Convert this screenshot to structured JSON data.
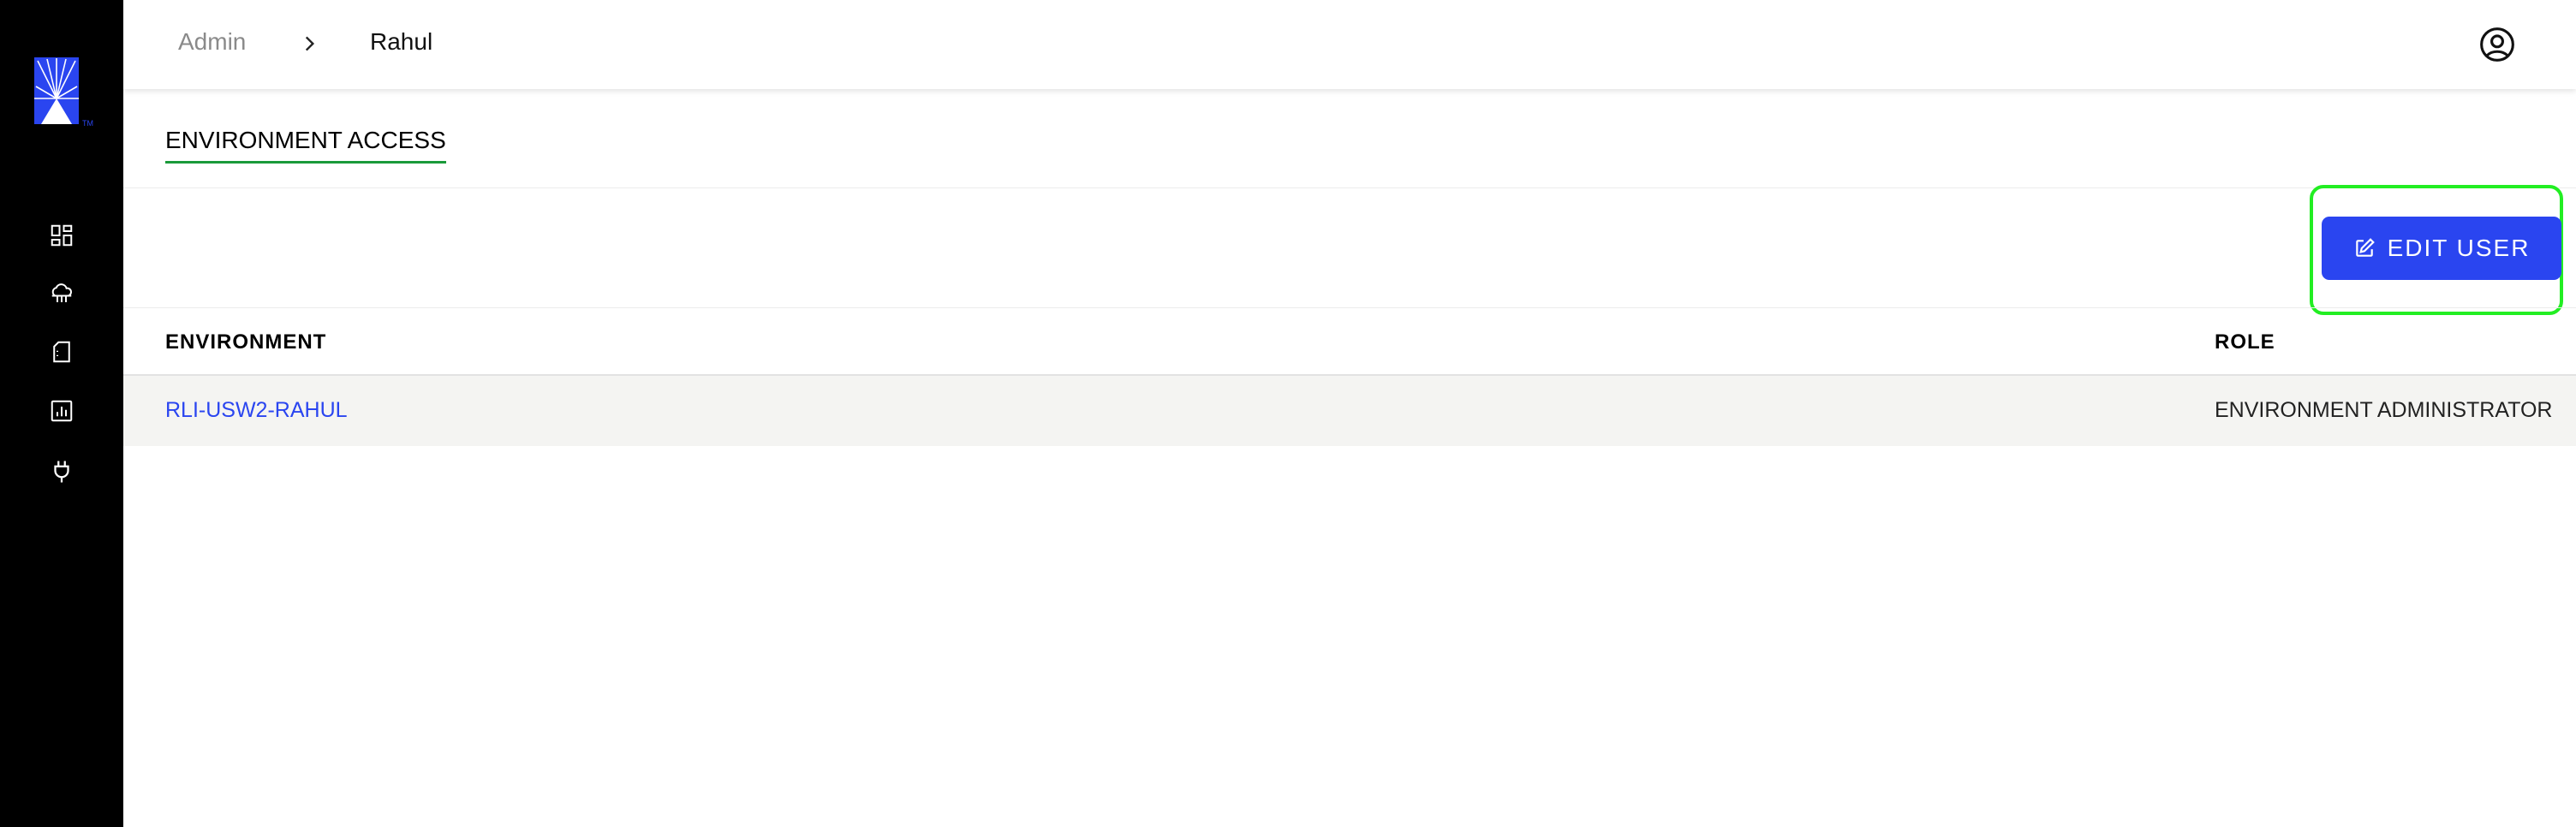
{
  "sidebar": {
    "logo": "brand-logo",
    "items": [
      {
        "icon": "dashboard-icon"
      },
      {
        "icon": "cloud-icon"
      },
      {
        "icon": "document-icon"
      },
      {
        "icon": "reports-icon"
      },
      {
        "icon": "plug-icon"
      }
    ]
  },
  "breadcrumb": {
    "root": "Admin",
    "current": "Rahul",
    "separator_icon": "chevron-right-icon"
  },
  "header": {
    "account_icon": "account-icon"
  },
  "tabs": [
    {
      "label": "ENVIRONMENT ACCESS",
      "active": true
    }
  ],
  "toolbar": {
    "edit_label": "EDIT USER",
    "edit_icon": "edit-icon"
  },
  "table": {
    "columns": [
      "ENVIRONMENT",
      "ROLE"
    ],
    "rows": [
      {
        "environment": "RLI-USW2-RAHUL",
        "role": "ENVIRONMENT ADMINISTRATOR"
      }
    ]
  },
  "colors": {
    "sidebar_bg": "#000000",
    "accent": "#2a45f0",
    "tab_underline": "#1a9a3a",
    "highlight": "#22ee22",
    "row_bg": "#f4f4f2"
  }
}
